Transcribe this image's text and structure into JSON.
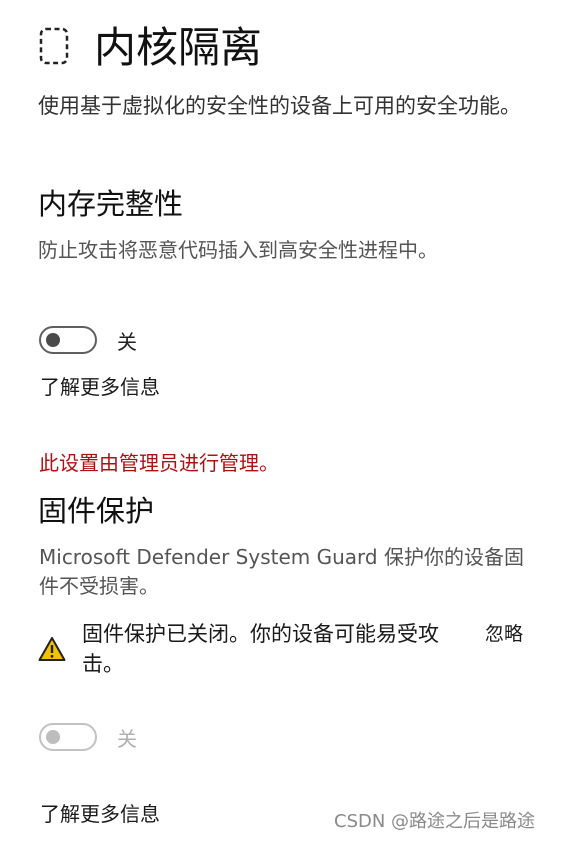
{
  "header": {
    "title": "内核隔离",
    "icon": "dashed-device-icon",
    "description": "使用基于虚拟化的安全性的设备上可用的安全功能。"
  },
  "memory_integrity": {
    "title": "内存完整性",
    "description": "防止攻击将恶意代码插入到高安全性进程中。",
    "toggle_state": "关",
    "learn_more": "了解更多信息"
  },
  "managed_notice": "此设置由管理员进行管理。",
  "firmware_protection": {
    "title": "固件保护",
    "description": "Microsoft Defender System Guard 保护你的设备固件不受损害。",
    "warning": {
      "icon": "warning-icon",
      "text": "固件保护已关闭。你的设备可能易受攻击。",
      "dismiss": "忽略"
    },
    "toggle_state": "关",
    "learn_more": "了解更多信息"
  },
  "watermark": "CSDN @路途之后是路途",
  "colors": {
    "managed_notice": "#b01010",
    "warning_fill": "#f2c200",
    "toggle_border": "#5f5f5f",
    "toggle_disabled": "#c2c2c2"
  }
}
